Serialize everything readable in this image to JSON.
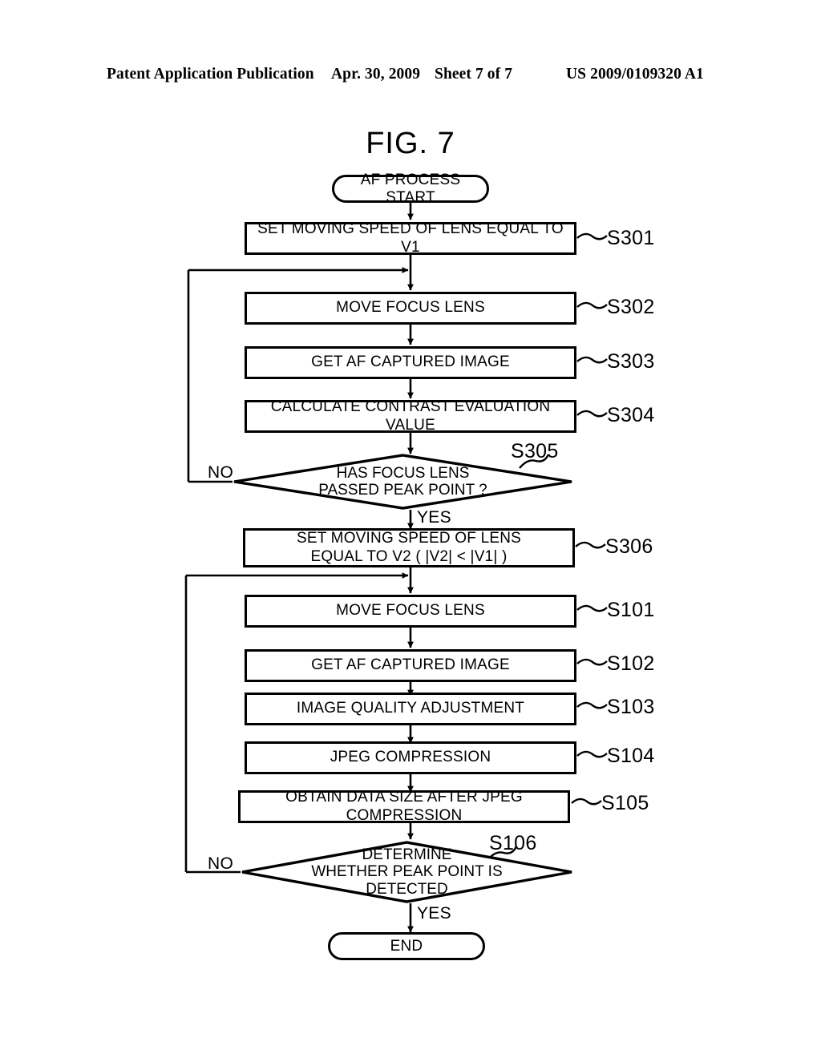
{
  "header": {
    "publication": "Patent Application Publication",
    "date": "Apr. 30, 2009",
    "sheet": "Sheet 7 of 7",
    "patent_number": "US 2009/0109320 A1"
  },
  "figure": {
    "title": "FIG. 7"
  },
  "flowchart": {
    "start": {
      "label": "AF PROCESS START"
    },
    "end": {
      "label": "END"
    },
    "steps": [
      {
        "id": "S301",
        "text": "SET MOVING SPEED OF LENS EQUAL TO V1",
        "ref": "S301"
      },
      {
        "id": "S302",
        "text": "MOVE FOCUS LENS",
        "ref": "S302"
      },
      {
        "id": "S303",
        "text": "GET AF CAPTURED IMAGE",
        "ref": "S303"
      },
      {
        "id": "S304",
        "text": "CALCULATE CONTRAST EVALUATION VALUE",
        "ref": "S304"
      },
      {
        "id": "S305",
        "text": "HAS FOCUS LENS\nPASSED PEAK POINT ?",
        "ref": "S305"
      },
      {
        "id": "S306",
        "text": "SET MOVING SPEED OF LENS\nEQUAL TO V2 ( |V2| < |V1| )",
        "ref": "S306"
      },
      {
        "id": "S101",
        "text": "MOVE FOCUS LENS",
        "ref": "S101"
      },
      {
        "id": "S102",
        "text": "GET AF CAPTURED IMAGE",
        "ref": "S102"
      },
      {
        "id": "S103",
        "text": "IMAGE QUALITY ADJUSTMENT",
        "ref": "S103"
      },
      {
        "id": "S104",
        "text": "JPEG COMPRESSION",
        "ref": "S104"
      },
      {
        "id": "S105",
        "text": "OBTAIN DATA SIZE AFTER JPEG COMPRESSION",
        "ref": "S105"
      },
      {
        "id": "S106",
        "text": "DETERMINE\nWHETHER PEAK POINT IS\nDETECTED",
        "ref": "S106"
      }
    ],
    "branches": {
      "s305_no": "NO",
      "s305_yes": "YES",
      "s106_no": "NO",
      "s106_yes": "YES"
    }
  },
  "colors": {
    "ink": "#000000",
    "paper": "#ffffff"
  }
}
